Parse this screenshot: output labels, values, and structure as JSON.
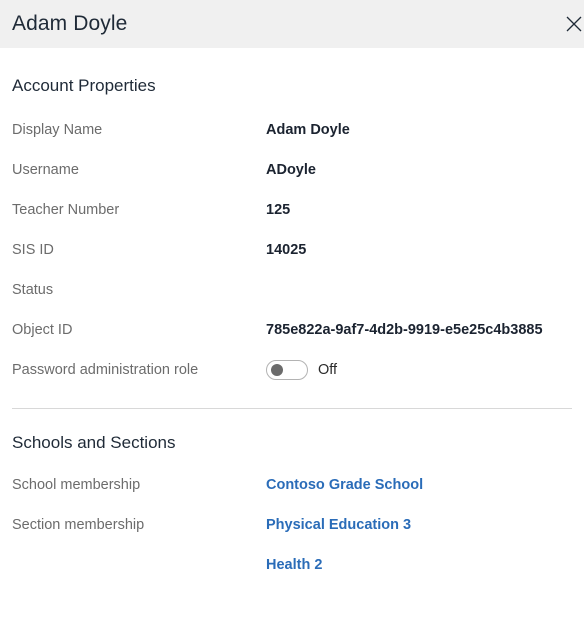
{
  "header": {
    "title": "Adam Doyle",
    "close_label": "Close"
  },
  "account_properties": {
    "heading": "Account Properties",
    "rows": [
      {
        "label": "Display Name",
        "value": "Adam Doyle"
      },
      {
        "label": "Username",
        "value": "ADoyle"
      },
      {
        "label": "Teacher Number",
        "value": "125"
      },
      {
        "label": "SIS ID",
        "value": "14025"
      },
      {
        "label": "Status",
        "value": ""
      },
      {
        "label": "Object ID",
        "value": "785e822a-9af7-4d2b-9919-e5e25c4b3885"
      }
    ],
    "toggle_row": {
      "label": "Password administration role",
      "state": "Off",
      "checked": false
    }
  },
  "schools_and_sections": {
    "heading": "Schools and Sections",
    "school_membership": {
      "label": "School membership",
      "values": [
        "Contoso Grade School"
      ]
    },
    "section_membership": {
      "label": "Section membership",
      "values": [
        "Physical Education 3",
        "Health 2"
      ]
    }
  },
  "colors": {
    "header_background": "#f0f0f0",
    "link": "#2a6cb8",
    "label_text": "#6c6c6c",
    "value_text": "#1b2330",
    "divider": "#d8d8d8"
  }
}
